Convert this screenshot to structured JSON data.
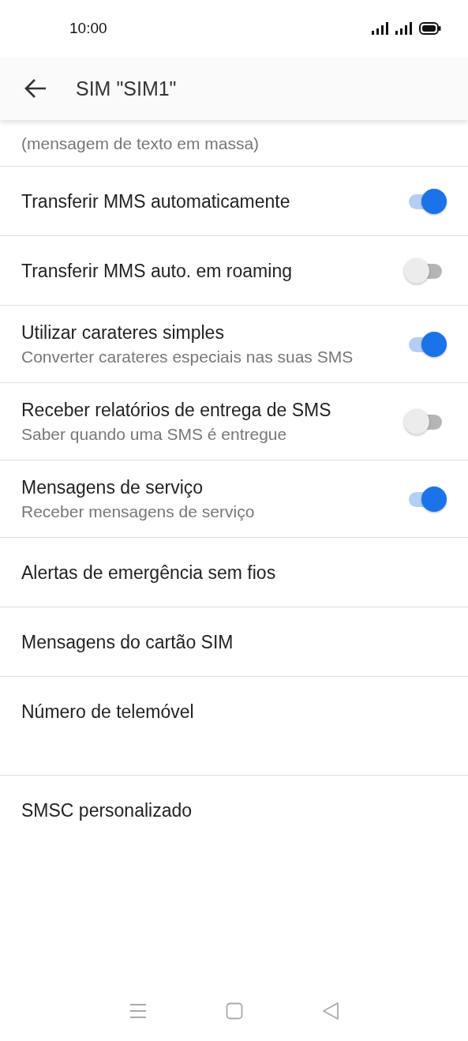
{
  "status_bar": {
    "time": "10:00"
  },
  "app_bar": {
    "title": "SIM \"SIM1\""
  },
  "partial_item": {
    "summary": "(mensagem de texto em massa)"
  },
  "items": [
    {
      "kind": "toggle",
      "title": "Transferir MMS automaticamente",
      "on": true
    },
    {
      "kind": "toggle",
      "title": "Transferir MMS auto. em roaming",
      "on": false
    },
    {
      "kind": "toggle",
      "title": "Utilizar carateres simples",
      "summary": "Converter carateres especiais nas suas SMS",
      "on": true
    },
    {
      "kind": "toggle",
      "title": "Receber relatórios de entrega de SMS",
      "summary": "Saber quando uma SMS é entregue",
      "on": false
    },
    {
      "kind": "toggle",
      "title": "Mensagens de serviço",
      "summary": "Receber mensagens de serviço",
      "on": true
    },
    {
      "kind": "link",
      "title": "Alertas de emergência sem fios"
    },
    {
      "kind": "link",
      "title": "Mensagens do cartão SIM"
    },
    {
      "kind": "link",
      "title": "Número de telemóvel"
    },
    {
      "kind": "link",
      "title": "SMSC personalizado"
    }
  ]
}
